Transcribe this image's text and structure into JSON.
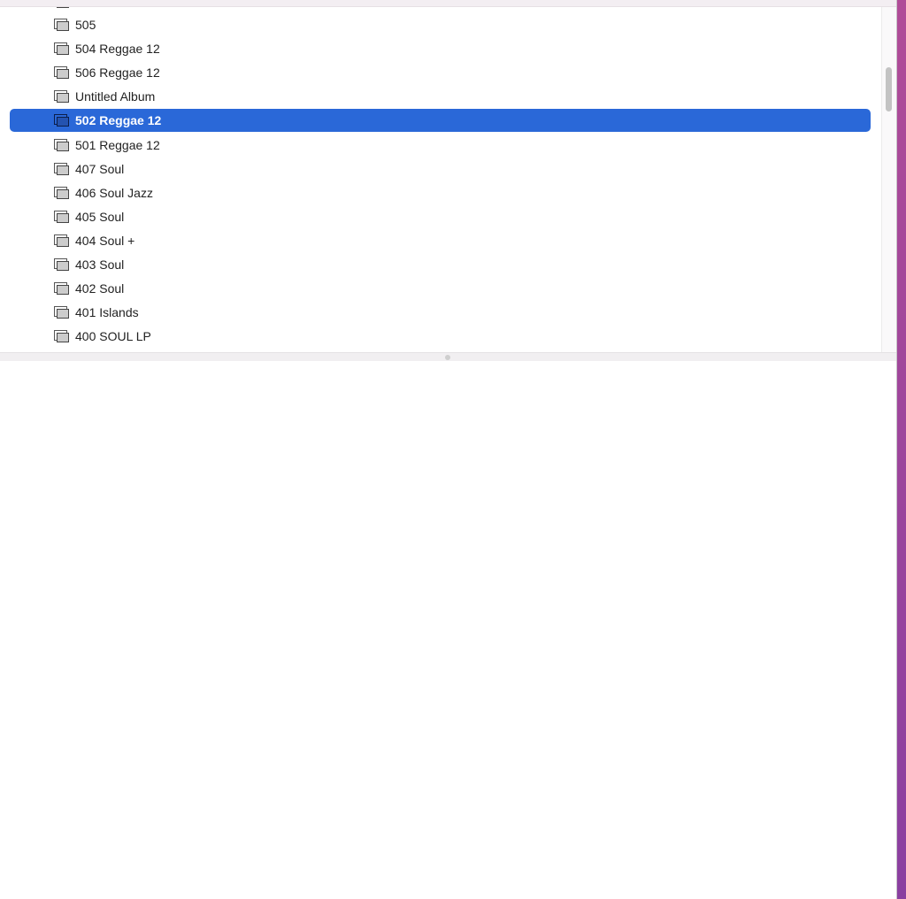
{
  "albums": [
    {
      "label": "505",
      "selected": false
    },
    {
      "label": "504 Reggae 12",
      "selected": false
    },
    {
      "label": "506 Reggae 12",
      "selected": false
    },
    {
      "label": "Untitled Album",
      "selected": false
    },
    {
      "label": "502 Reggae 12",
      "selected": true
    },
    {
      "label": "501 Reggae 12",
      "selected": false
    },
    {
      "label": "407 Soul",
      "selected": false
    },
    {
      "label": "406 Soul Jazz",
      "selected": false
    },
    {
      "label": "405 Soul",
      "selected": false
    },
    {
      "label": "404 Soul +",
      "selected": false
    },
    {
      "label": "403 Soul",
      "selected": false
    },
    {
      "label": "402 Soul",
      "selected": false
    },
    {
      "label": "401 Islands",
      "selected": false
    },
    {
      "label": "400 SOUL LP",
      "selected": false
    }
  ],
  "colors": {
    "selection": "#2a68d8",
    "desktop": "#9b459c"
  },
  "icons": {
    "album": "album-stack-icon"
  }
}
